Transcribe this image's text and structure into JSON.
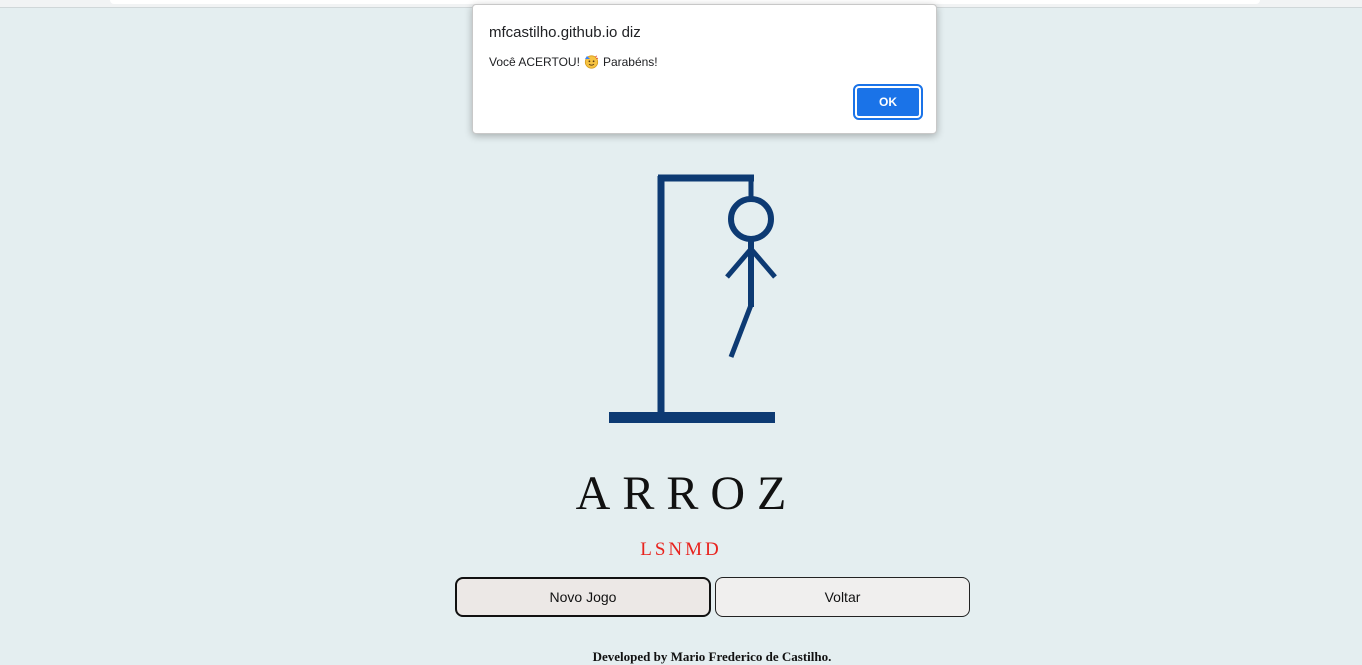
{
  "dialog": {
    "origin": "mfcastilho.github.io diz",
    "message": "Você ACERTOU!",
    "message_suffix": "Parabéns!",
    "emoji_icon": "party-face-icon",
    "ok_label": "OK"
  },
  "game": {
    "word": "ARROZ",
    "wrong_letters": "LSNMD",
    "errors_shown": 5
  },
  "buttons": {
    "new_game": "Novo Jogo",
    "back": "Voltar"
  },
  "footer": {
    "text": "Developed by Mario Frederico de Castilho."
  },
  "colors": {
    "background": "#e4eef0",
    "gallows": "#0d3a73",
    "wrong_letters": "#e8231e",
    "ok_button": "#1a73e8"
  }
}
